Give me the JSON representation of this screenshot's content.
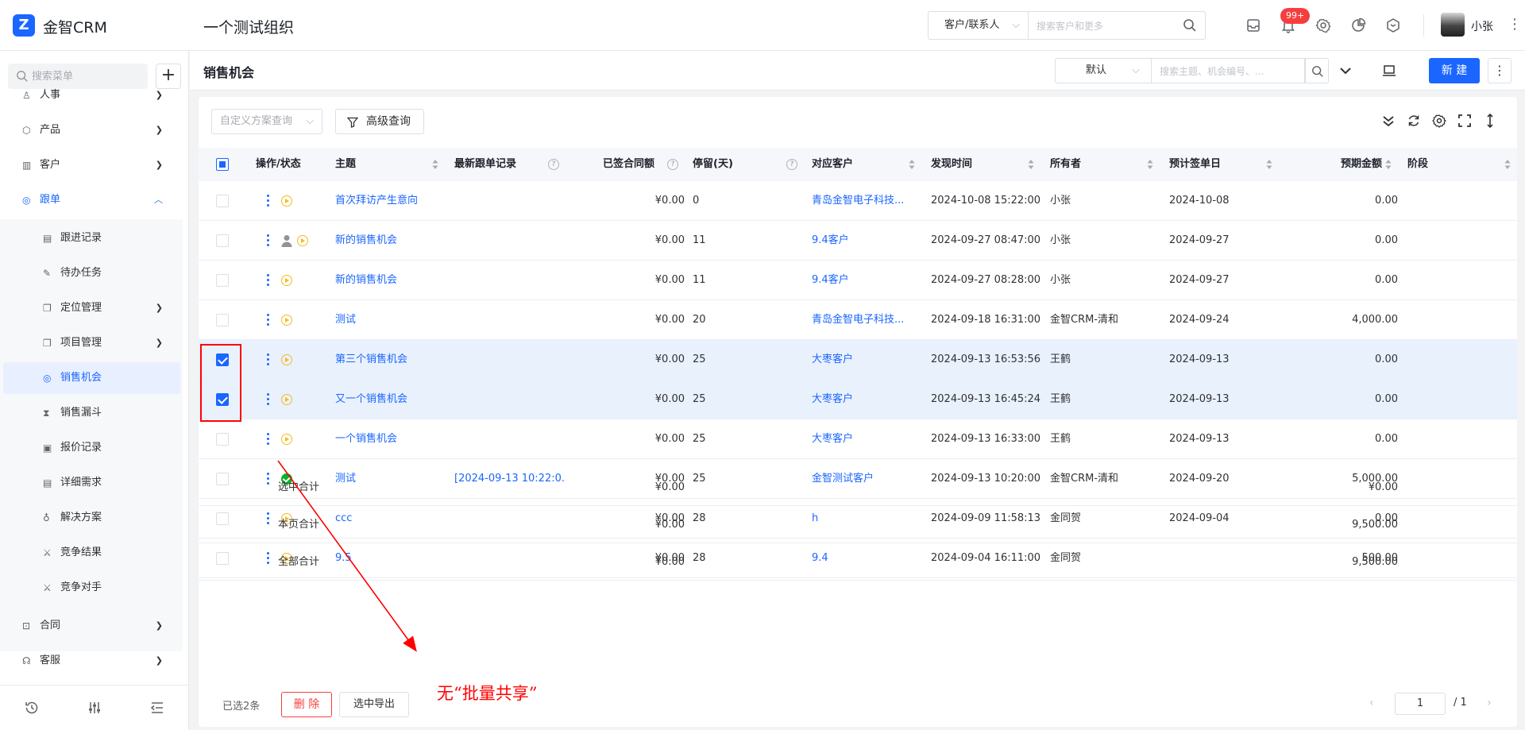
{
  "app": {
    "logo_glyph": "Z",
    "name": "金智CRM",
    "org": "一个测试组织",
    "accent": "#1a66ff"
  },
  "topbar": {
    "search_type": "客户/联系人",
    "search_placeholder": "搜索客户和更多",
    "notification_count": "99+",
    "user_name": "小张",
    "icons": [
      "inbox-icon",
      "bell-icon",
      "gear-icon",
      "pie-chart-icon",
      "cube-icon"
    ]
  },
  "sidebar": {
    "search_placeholder": "搜索菜单",
    "add_label": "+",
    "top_items": [
      {
        "label": "人事",
        "icon": "people-icon"
      },
      {
        "label": "产品",
        "icon": "cube-icon"
      },
      {
        "label": "客户",
        "icon": "chart-icon"
      },
      {
        "label": "跟单",
        "icon": "target-icon"
      }
    ],
    "sub_items": [
      {
        "label": "跟进记录",
        "icon": "doc-icon"
      },
      {
        "label": "待办任务",
        "icon": "pin-icon"
      },
      {
        "label": "定位管理",
        "icon": "layers-icon"
      },
      {
        "label": "项目管理",
        "icon": "layers-icon"
      },
      {
        "label": "销售机会",
        "icon": "target-icon"
      },
      {
        "label": "销售漏斗",
        "icon": "hourglass-icon"
      },
      {
        "label": "报价记录",
        "icon": "file-icon"
      },
      {
        "label": "详细需求",
        "icon": "doc-icon"
      },
      {
        "label": "解决方案",
        "icon": "bulb-icon"
      },
      {
        "label": "竞争结果",
        "icon": "swords-icon"
      },
      {
        "label": "竞争对手",
        "icon": "swords-icon"
      }
    ],
    "bottom_items": [
      {
        "label": "合同",
        "icon": "contract-icon"
      },
      {
        "label": "客服",
        "icon": "headset-icon"
      }
    ]
  },
  "page": {
    "title": "销售机会",
    "view": "默认",
    "search_placeholder": "搜索主题、机会编号、...",
    "new_label": "新 建"
  },
  "toolbar": {
    "scheme_placeholder": "自定义方案查询",
    "advanced_label": "高级查询"
  },
  "table": {
    "columns": [
      "操作/状态",
      "主题",
      "最新跟单记录",
      "已签合同额",
      "停留(天)",
      "对应客户",
      "发现时间",
      "所有者",
      "预计签单日",
      "预期金额",
      "阶段"
    ],
    "rows": [
      {
        "selected": false,
        "status": "play",
        "user": false,
        "subject": "首次拜访产生意向",
        "latest": "",
        "contract": "¥0.00",
        "stay": "0",
        "customer": "青岛金智电子科技...",
        "found": "2024-10-08 15:22:00",
        "owner": "小张",
        "sign_date": "2024-10-08",
        "amount": "0.00",
        "stage": ""
      },
      {
        "selected": false,
        "status": "play",
        "user": true,
        "subject": "新的销售机会",
        "latest": "",
        "contract": "¥0.00",
        "stay": "11",
        "customer": "9.4客户",
        "found": "2024-09-27 08:47:00",
        "owner": "小张",
        "sign_date": "2024-09-27",
        "amount": "0.00",
        "stage": ""
      },
      {
        "selected": false,
        "status": "play",
        "user": false,
        "subject": "新的销售机会",
        "latest": "",
        "contract": "¥0.00",
        "stay": "11",
        "customer": "9.4客户",
        "found": "2024-09-27 08:28:00",
        "owner": "小张",
        "sign_date": "2024-09-27",
        "amount": "0.00",
        "stage": ""
      },
      {
        "selected": false,
        "status": "play",
        "user": false,
        "subject": "测试",
        "latest": "",
        "contract": "¥0.00",
        "stay": "20",
        "customer": "青岛金智电子科技...",
        "found": "2024-09-18 16:31:00",
        "owner": "金智CRM-清和",
        "sign_date": "2024-09-24",
        "amount": "4,000.00",
        "stage": ""
      },
      {
        "selected": true,
        "status": "play",
        "user": false,
        "subject": "第三个销售机会",
        "latest": "",
        "contract": "¥0.00",
        "stay": "25",
        "customer": "大枣客户",
        "found": "2024-09-13 16:53:56",
        "owner": "王鹤",
        "sign_date": "2024-09-13",
        "amount": "0.00",
        "stage": ""
      },
      {
        "selected": true,
        "status": "play",
        "user": false,
        "subject": "又一个销售机会",
        "latest": "",
        "contract": "¥0.00",
        "stay": "25",
        "customer": "大枣客户",
        "found": "2024-09-13 16:45:24",
        "owner": "王鹤",
        "sign_date": "2024-09-13",
        "amount": "0.00",
        "stage": ""
      },
      {
        "selected": false,
        "status": "play",
        "user": false,
        "subject": "一个销售机会",
        "latest": "",
        "contract": "¥0.00",
        "stay": "25",
        "customer": "大枣客户",
        "found": "2024-09-13 16:33:00",
        "owner": "王鹤",
        "sign_date": "2024-09-13",
        "amount": "0.00",
        "stage": ""
      },
      {
        "selected": false,
        "status": "ok",
        "user": false,
        "subject": "测试",
        "latest": "[2024-09-13 10:22:0...",
        "contract": "¥0.00",
        "stay": "25",
        "customer": "金智测试客户",
        "found": "2024-09-13 10:20:00",
        "owner": "金智CRM-清和",
        "sign_date": "2024-09-20",
        "amount": "5,000.00",
        "stage": ""
      },
      {
        "selected": false,
        "status": "play",
        "user": false,
        "subject": "ccc",
        "latest": "",
        "contract": "¥0.00",
        "stay": "28",
        "customer": "h",
        "found": "2024-09-09 11:58:13",
        "owner": "金同贺",
        "sign_date": "2024-09-04",
        "amount": "0.00",
        "stage": ""
      },
      {
        "selected": false,
        "status": "play",
        "user": false,
        "subject": "9.5",
        "latest": "",
        "contract": "¥0.00",
        "stay": "28",
        "customer": "9.4",
        "found": "2024-09-04 16:11:00",
        "owner": "金同贺",
        "sign_date": "",
        "amount": "500.00",
        "stage": ""
      }
    ],
    "summary": [
      {
        "label": "选中合计",
        "contract": "¥0.00",
        "amount": "¥0.00"
      },
      {
        "label": "本页合计",
        "contract": "¥0.00",
        "amount": "9,500.00"
      },
      {
        "label": "全部合计",
        "contract": "¥0.00",
        "amount": "9,500.00"
      }
    ]
  },
  "footer": {
    "selected_text": "已选2条",
    "delete_label": "删 除",
    "export_label": "选中导出",
    "prev": "‹",
    "next": "›",
    "page": "1",
    "total": "/ 1"
  },
  "annotation": {
    "text": "无“批量共享”",
    "color": "#ff0000"
  }
}
